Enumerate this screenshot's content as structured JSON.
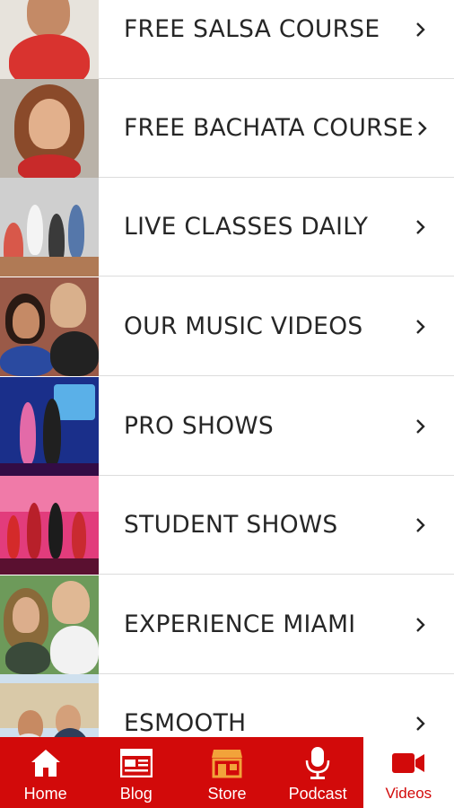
{
  "list": {
    "items": [
      {
        "label": "FREE SALSA COURSE",
        "thumb": "salsa-instructor-photo"
      },
      {
        "label": "FREE BACHATA COURSE",
        "thumb": "bachata-instructor-photo"
      },
      {
        "label": "LIVE CLASSES DAILY",
        "thumb": "class-group-photo"
      },
      {
        "label": "OUR MUSIC VIDEOS",
        "thumb": "music-video-photo"
      },
      {
        "label": "PRO SHOWS",
        "thumb": "pro-show-photo"
      },
      {
        "label": "STUDENT SHOWS",
        "thumb": "student-show-photo"
      },
      {
        "label": "EXPERIENCE MIAMI",
        "thumb": "miami-couple-photo"
      },
      {
        "label": "ESMOOTH",
        "thumb": "esmooth-photo"
      }
    ]
  },
  "tabbar": {
    "tabs": [
      {
        "label": "Home",
        "icon": "home-icon"
      },
      {
        "label": "Blog",
        "icon": "blog-icon"
      },
      {
        "label": "Store",
        "icon": "store-icon"
      },
      {
        "label": "Podcast",
        "icon": "microphone-icon"
      },
      {
        "label": "Videos",
        "icon": "video-camera-icon"
      }
    ],
    "active": "Videos"
  },
  "colors": {
    "accent": "#d20a0a",
    "store_icon": "#f2a33a",
    "text": "#262626"
  }
}
